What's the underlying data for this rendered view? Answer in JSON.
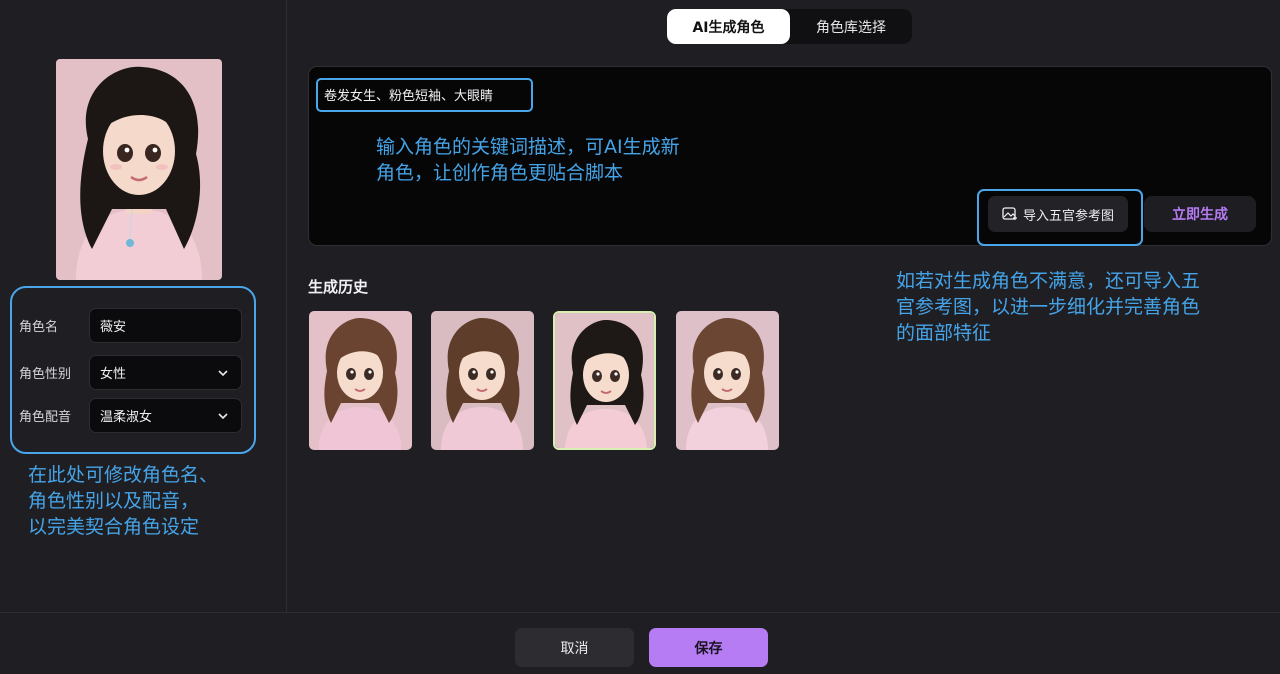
{
  "tabs": [
    {
      "label": "AI生成角色",
      "active": true
    },
    {
      "label": "角色库选择",
      "active": false
    }
  ],
  "character_form": {
    "name_label": "角色名",
    "name_value": "薇安",
    "gender_label": "角色性别",
    "gender_value": "女性",
    "voice_label": "角色配音",
    "voice_value": "温柔淑女"
  },
  "prompt": {
    "value": "卷发女生、粉色短袖、大眼睛",
    "import_label": "导入五官参考图",
    "generate_label": "立即生成"
  },
  "history": {
    "title": "生成历史",
    "selected_index": 2,
    "items": [
      {
        "hair": "#6a4430",
        "shirt": "#f0c6d6",
        "bg": "#e4c1c8",
        "icon": "portrait-girl-pigtail"
      },
      {
        "hair": "#5e3d2a",
        "shirt": "#efcad6",
        "bg": "#d9bcc2",
        "icon": "portrait-girl-curly"
      },
      {
        "hair": "#1e1816",
        "shirt": "#f3ccd6",
        "bg": "#e0c2c6",
        "icon": "portrait-girl-long-hair"
      },
      {
        "hair": "#6b4632",
        "shirt": "#f2d1dc",
        "bg": "#dec1c8",
        "icon": "portrait-girl-collar"
      }
    ]
  },
  "annotations": {
    "left_note": "在此处可修改角色名、角色性别以及配音，以完美契合角色设定",
    "left_lines": [
      "在此处可修改角色名、",
      "角色性别以及配音，",
      "以完美契合角色设定"
    ],
    "prompt_lines": [
      "输入角色的关键词描述，可AI生成新",
      "角色，让创作角色更贴合脚本"
    ],
    "import_lines": [
      "如若对生成角色不满意，还可导入五",
      "官参考图，以进一步细化并完善角色",
      "的面部特征"
    ]
  },
  "footer": {
    "cancel_label": "取消",
    "save_label": "保存"
  },
  "colors": {
    "accent": "#b57cf4",
    "annotation_blue": "#4aa6e8",
    "background": "#1f1e23"
  }
}
